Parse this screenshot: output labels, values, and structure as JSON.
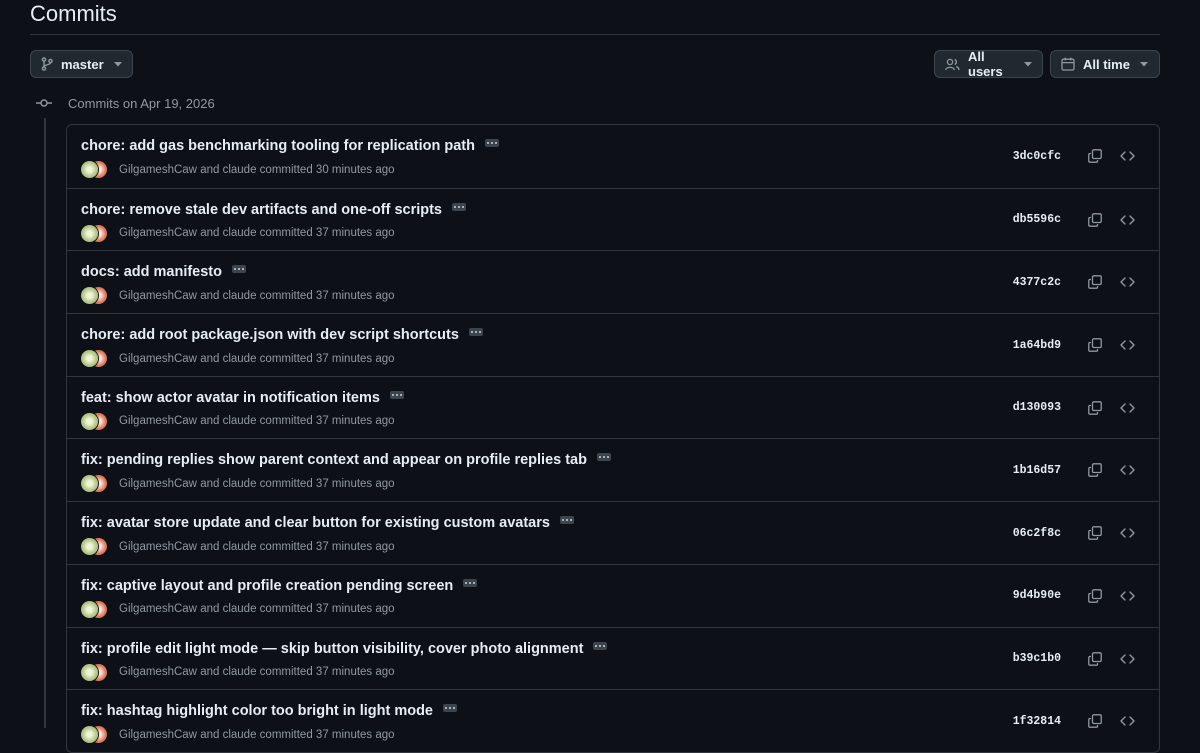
{
  "page": {
    "title": "Commits"
  },
  "toolbar": {
    "branch_label": "master",
    "users_label": "All users",
    "time_label": "All time"
  },
  "group": {
    "heading": "Commits on Apr 19, 2026"
  },
  "commits": [
    {
      "message": "chore: add gas benchmarking tooling for replication path",
      "author1": "GilgameshCaw",
      "and": "and",
      "author2": "claude",
      "verb": "committed",
      "time": "30 minutes ago",
      "sha": "3dc0cfc"
    },
    {
      "message": "chore: remove stale dev artifacts and one-off scripts",
      "author1": "GilgameshCaw",
      "and": "and",
      "author2": "claude",
      "verb": "committed",
      "time": "37 minutes ago",
      "sha": "db5596c"
    },
    {
      "message": "docs: add manifesto",
      "author1": "GilgameshCaw",
      "and": "and",
      "author2": "claude",
      "verb": "committed",
      "time": "37 minutes ago",
      "sha": "4377c2c"
    },
    {
      "message": "chore: add root package.json with dev script shortcuts",
      "author1": "GilgameshCaw",
      "and": "and",
      "author2": "claude",
      "verb": "committed",
      "time": "37 minutes ago",
      "sha": "1a64bd9"
    },
    {
      "message": "feat: show actor avatar in notification items",
      "author1": "GilgameshCaw",
      "and": "and",
      "author2": "claude",
      "verb": "committed",
      "time": "37 minutes ago",
      "sha": "d130093"
    },
    {
      "message": "fix: pending replies show parent context and appear on profile replies tab",
      "author1": "GilgameshCaw",
      "and": "and",
      "author2": "claude",
      "verb": "committed",
      "time": "37 minutes ago",
      "sha": "1b16d57"
    },
    {
      "message": "fix: avatar store update and clear button for existing custom avatars",
      "author1": "GilgameshCaw",
      "and": "and",
      "author2": "claude",
      "verb": "committed",
      "time": "37 minutes ago",
      "sha": "06c2f8c"
    },
    {
      "message": "fix: captive layout and profile creation pending screen",
      "author1": "GilgameshCaw",
      "and": "and",
      "author2": "claude",
      "verb": "committed",
      "time": "37 minutes ago",
      "sha": "9d4b90e"
    },
    {
      "message": "fix: profile edit light mode — skip button visibility, cover photo alignment",
      "author1": "GilgameshCaw",
      "and": "and",
      "author2": "claude",
      "verb": "committed",
      "time": "37 minutes ago",
      "sha": "b39c1b0"
    },
    {
      "message": "fix: hashtag highlight color too bright in light mode",
      "author1": "GilgameshCaw",
      "and": "and",
      "author2": "claude",
      "verb": "committed",
      "time": "37 minutes ago",
      "sha": "1f32814"
    }
  ],
  "icons": {
    "branch": "git-branch-icon",
    "caret": "triangle-down-icon",
    "people": "people-icon",
    "calendar": "calendar-icon",
    "commit": "git-commit-icon",
    "copy": "copy-icon",
    "code": "code-icon",
    "ellipsis": "ellipsis-icon"
  },
  "colors": {
    "background": "#0d1117",
    "border": "#30363d",
    "text": "#e6edf3",
    "muted": "#9198a1",
    "button_bg": "#212830"
  }
}
